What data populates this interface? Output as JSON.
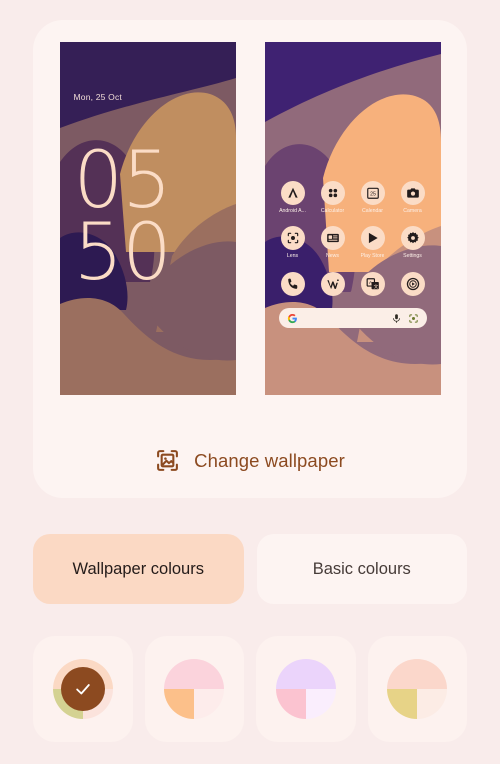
{
  "theme": {
    "page_background": "#f9eceb",
    "card_background": "#fdf4f2",
    "accent": "#8c4a20",
    "tab_selected_bg": "#fbd9c4",
    "tab_unselected_bg": "#fdf4f2"
  },
  "lock_screen": {
    "date": "Mon, 25 Oct",
    "time_hours": "05",
    "time_minutes": "50",
    "clock_color": "#fbdcc6",
    "date_color": "#f0dcd6",
    "wallpaper_colors": {
      "dark_purple": "#351f56",
      "mauve": "#7d5a63",
      "plum": "#543156",
      "tan": "#c08e60",
      "rose_brown": "#9b6f5f",
      "deep_indigo": "#2d1a52"
    }
  },
  "home_screen": {
    "wallpaper_colors": {
      "dark_purple": "#3f2272",
      "mauve": "#916a7b",
      "orange": "#f7b17c",
      "plum": "#6b4370",
      "rose": "#c8917e",
      "deep_indigo": "#3a1f6b"
    },
    "icon_bg": "#fbdcc6",
    "icon_fg": "#231c1c",
    "label_color": "#fdf0e8",
    "apps": [
      {
        "label": "Android A...",
        "icon": "android-auto-icon"
      },
      {
        "label": "Calculator",
        "icon": "calculator-icon"
      },
      {
        "label": "Calendar",
        "icon": "calendar-icon"
      },
      {
        "label": "Camera",
        "icon": "camera-icon"
      },
      {
        "label": "Lens",
        "icon": "lens-icon"
      },
      {
        "label": "News",
        "icon": "news-icon"
      },
      {
        "label": "Play Store",
        "icon": "play-store-icon"
      },
      {
        "label": "Settings",
        "icon": "settings-gear-icon"
      }
    ],
    "dock": [
      {
        "label": "Phone",
        "icon": "phone-icon"
      },
      {
        "label": "Wallet",
        "icon": "wallet-icon"
      },
      {
        "label": "Translate",
        "icon": "translate-icon"
      },
      {
        "label": "Record",
        "icon": "record-circle-icon"
      }
    ],
    "search_bar": {
      "google_letter": "G",
      "background": "#fbeee7",
      "mic_icon": "microphone-icon",
      "lens_icon": "google-lens-icon"
    }
  },
  "change_wallpaper": {
    "label": "Change wallpaper",
    "icon": "image-frame-icon",
    "color": "#8c4a20"
  },
  "tabs": [
    {
      "label": "Wallpaper colours",
      "selected": true
    },
    {
      "label": "Basic colours",
      "selected": false
    }
  ],
  "colour_swatches": [
    {
      "name": "swatch-1",
      "selected": true,
      "top_left": "#fbd9c4",
      "top_right": "#fbd9c4",
      "bottom_left": "#d4d292",
      "bottom_right": "#fbe3dc",
      "selected_disc": "#8c4a20",
      "check_icon": "check-icon"
    },
    {
      "name": "swatch-2",
      "selected": false,
      "top_left": "#fbd3dc",
      "top_right": "#fbd3dc",
      "bottom_left": "#fcc08a",
      "bottom_right": "#fdeceb"
    },
    {
      "name": "swatch-3",
      "selected": false,
      "top_left": "#ebd4fb",
      "top_right": "#ebd4fb",
      "bottom_left": "#fbc3d0",
      "bottom_right": "#faeefd"
    },
    {
      "name": "swatch-4",
      "selected": false,
      "top_left": "#fbd7cb",
      "top_right": "#fbd7cb",
      "bottom_left": "#e7d387",
      "bottom_right": "#fcece5"
    }
  ]
}
